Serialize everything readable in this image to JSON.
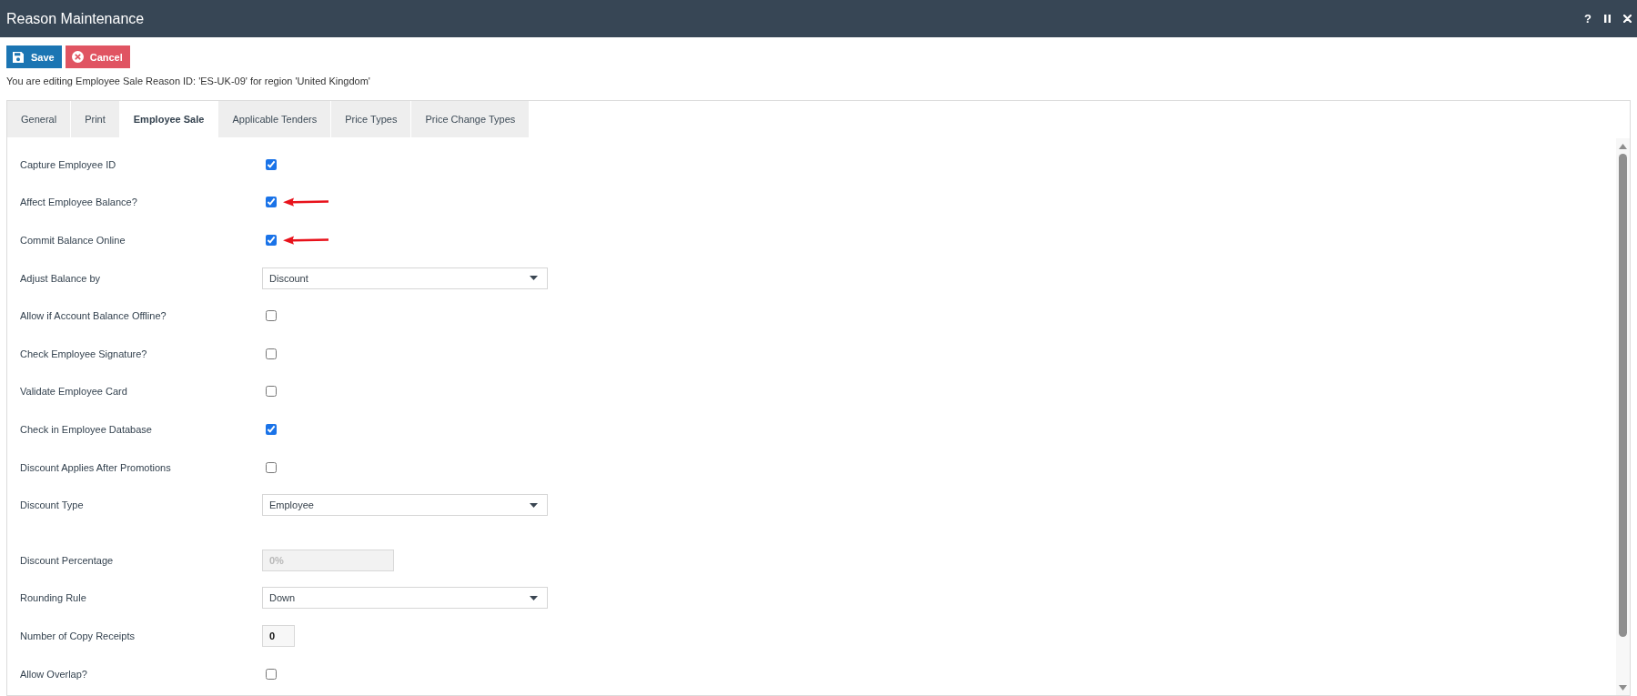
{
  "window": {
    "title": "Reason Maintenance",
    "help": "?"
  },
  "toolbar": {
    "buttons": [
      {
        "kind": "save",
        "label": "Save"
      },
      {
        "kind": "cancel",
        "label": "Cancel"
      }
    ]
  },
  "info": "You are editing Employee Sale Reason ID: 'ES-UK-09' for region 'United Kingdom'",
  "tabs": [
    {
      "label": "General",
      "selected": false
    },
    {
      "label": "Print",
      "selected": false
    },
    {
      "label": "Employee Sale",
      "selected": true
    },
    {
      "label": "Applicable Tenders",
      "selected": false
    },
    {
      "label": "Price Types",
      "selected": false
    },
    {
      "label": "Price Change Types",
      "selected": false
    }
  ],
  "form": {
    "rows": [
      {
        "kind": "checkbox",
        "label": "Capture Employee ID",
        "checked": true,
        "pointer_arrow": false
      },
      {
        "kind": "checkbox",
        "label": "Affect Employee Balance?",
        "checked": true,
        "pointer_arrow": true
      },
      {
        "kind": "checkbox",
        "label": "Commit Balance Online",
        "checked": true,
        "pointer_arrow": true
      },
      {
        "kind": "select",
        "label": "Adjust Balance by",
        "value": "Discount"
      },
      {
        "kind": "checkbox",
        "label": "Allow if Account Balance Offline?",
        "checked": false,
        "pointer_arrow": false
      },
      {
        "kind": "checkbox",
        "label": "Check Employee Signature?",
        "checked": false,
        "pointer_arrow": false
      },
      {
        "kind": "checkbox",
        "label": "Validate Employee Card",
        "checked": false,
        "pointer_arrow": false
      },
      {
        "kind": "checkbox",
        "label": "Check in Employee Database",
        "checked": true,
        "pointer_arrow": false
      },
      {
        "kind": "checkbox",
        "label": "Discount Applies After Promotions",
        "checked": false,
        "pointer_arrow": false
      },
      {
        "kind": "select",
        "label": "Discount Type",
        "value": "Employee"
      },
      {
        "kind": "input",
        "label": "Discount Percentage",
        "value": "0%",
        "disabled": true
      },
      {
        "kind": "select",
        "label": "Rounding Rule",
        "value": "Down"
      },
      {
        "kind": "number",
        "label": "Number of Copy Receipts",
        "value": "0",
        "disabled": false
      },
      {
        "kind": "checkbox",
        "label": "Allow Overlap?",
        "checked": false,
        "pointer_arrow": false
      }
    ]
  }
}
